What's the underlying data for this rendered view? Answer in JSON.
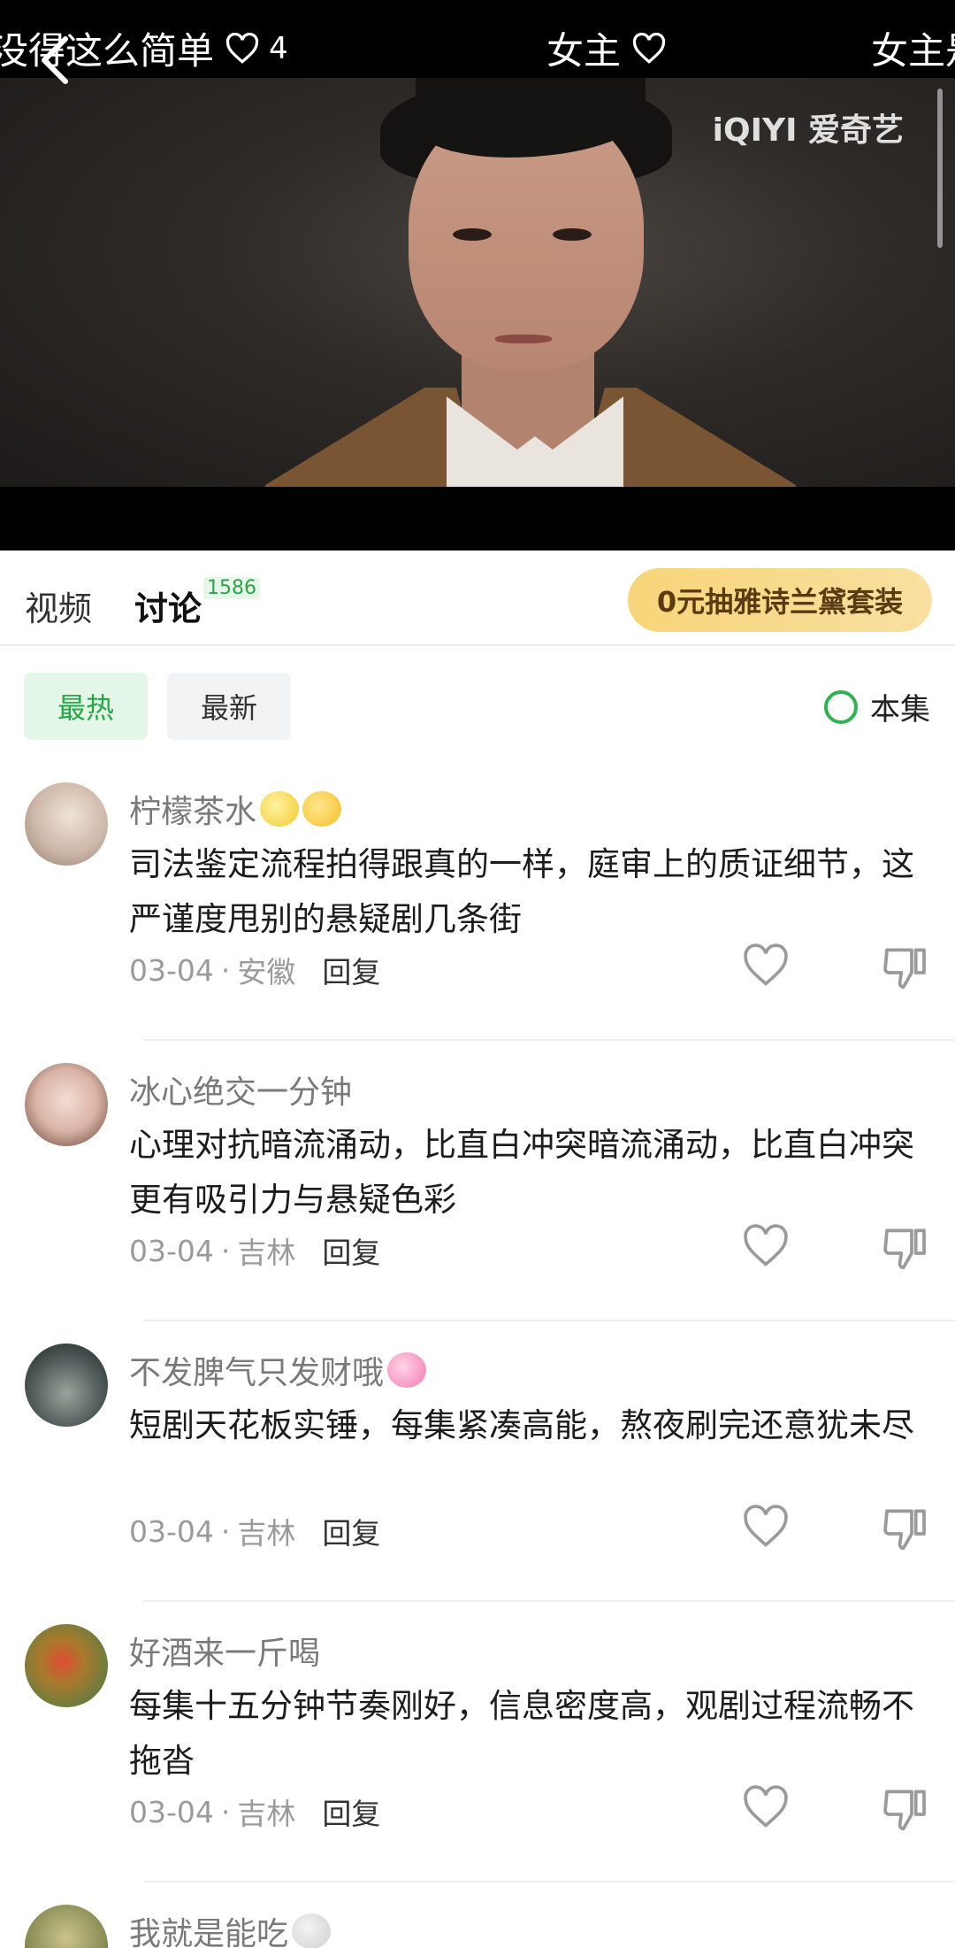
{
  "danmaku": [
    {
      "text": "没得这么简单",
      "count": "4"
    },
    {
      "text": "女主",
      "count": ""
    },
    {
      "text": "女主是",
      "count": ""
    }
  ],
  "player": {
    "watermark": "iQIYI 爱奇艺"
  },
  "tabs": {
    "video_label": "视频",
    "discussion_label": "讨论",
    "discussion_count": "1586",
    "promo_label": "0元抽雅诗兰黛套装"
  },
  "filters": {
    "hot_label": "最热",
    "new_label": "最新",
    "episode_label": "本集"
  },
  "comments": [
    {
      "username": "柠檬茶水",
      "text": "司法鉴定流程拍得跟真的一样，庭审上的质证细节，这严谨度甩别的悬疑剧几条街",
      "date": "03-04",
      "location": "安徽",
      "reply": "回复",
      "avatar_color": "#cdb7a8",
      "emojis": [
        "lemon-emoji",
        "grin-emoji"
      ]
    },
    {
      "username": "冰心绝交一分钟",
      "text": "心理对抗暗流涌动，比直白冲突暗流涌动，比直白冲突更有吸引力与悬疑色彩",
      "date": "03-04",
      "location": "吉林",
      "reply": "回复",
      "avatar_color": "#d9b4a6",
      "emojis": []
    },
    {
      "username": "不发脾气只发财哦",
      "text": "短剧天花板实锤，每集紧凑高能，熬夜刷完还意犹未尽",
      "date": "03-04",
      "location": "吉林",
      "reply": "回复",
      "avatar_color": "#4e5a58",
      "emojis": [
        "hearts-emoji"
      ]
    },
    {
      "username": "好酒来一斤喝",
      "text": "每集十五分钟节奏刚好，信息密度高，观剧过程流畅不拖沓",
      "date": "03-04",
      "location": "吉林",
      "reply": "回复",
      "avatar_color": "#6e7c3d",
      "emojis": []
    },
    {
      "username": "我就是能吃",
      "text": "",
      "date": "",
      "location": "",
      "reply": "",
      "avatar_color": "#8a8d55",
      "emojis": [
        "face-emoji"
      ]
    }
  ],
  "colors": {
    "accent_green": "#2fb351",
    "promo_gold": "#f7d579"
  }
}
